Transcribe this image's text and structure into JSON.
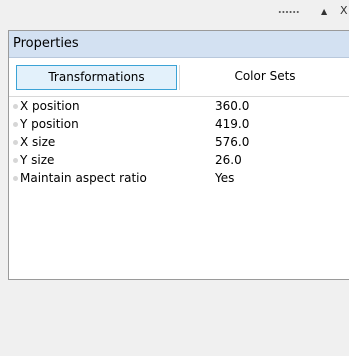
{
  "window": {
    "grip_icon": "grip-dots-icon",
    "arrow_icon": "triangle-up-icon",
    "arrow_glyph": "▲",
    "close_icon": "close-icon",
    "close_glyph": "X"
  },
  "panel": {
    "title": "Properties",
    "header_color": "#d3e1f2",
    "tabs": [
      {
        "label": "Transformations",
        "selected": true
      },
      {
        "label": "Color Sets",
        "selected": false
      }
    ],
    "properties": [
      {
        "label": "X position",
        "value": "360.0"
      },
      {
        "label": "Y position",
        "value": "419.0"
      },
      {
        "label": "X size",
        "value": "576.0"
      },
      {
        "label": "Y size",
        "value": "26.0"
      },
      {
        "label": "Maintain aspect ratio",
        "value": "Yes"
      }
    ]
  }
}
